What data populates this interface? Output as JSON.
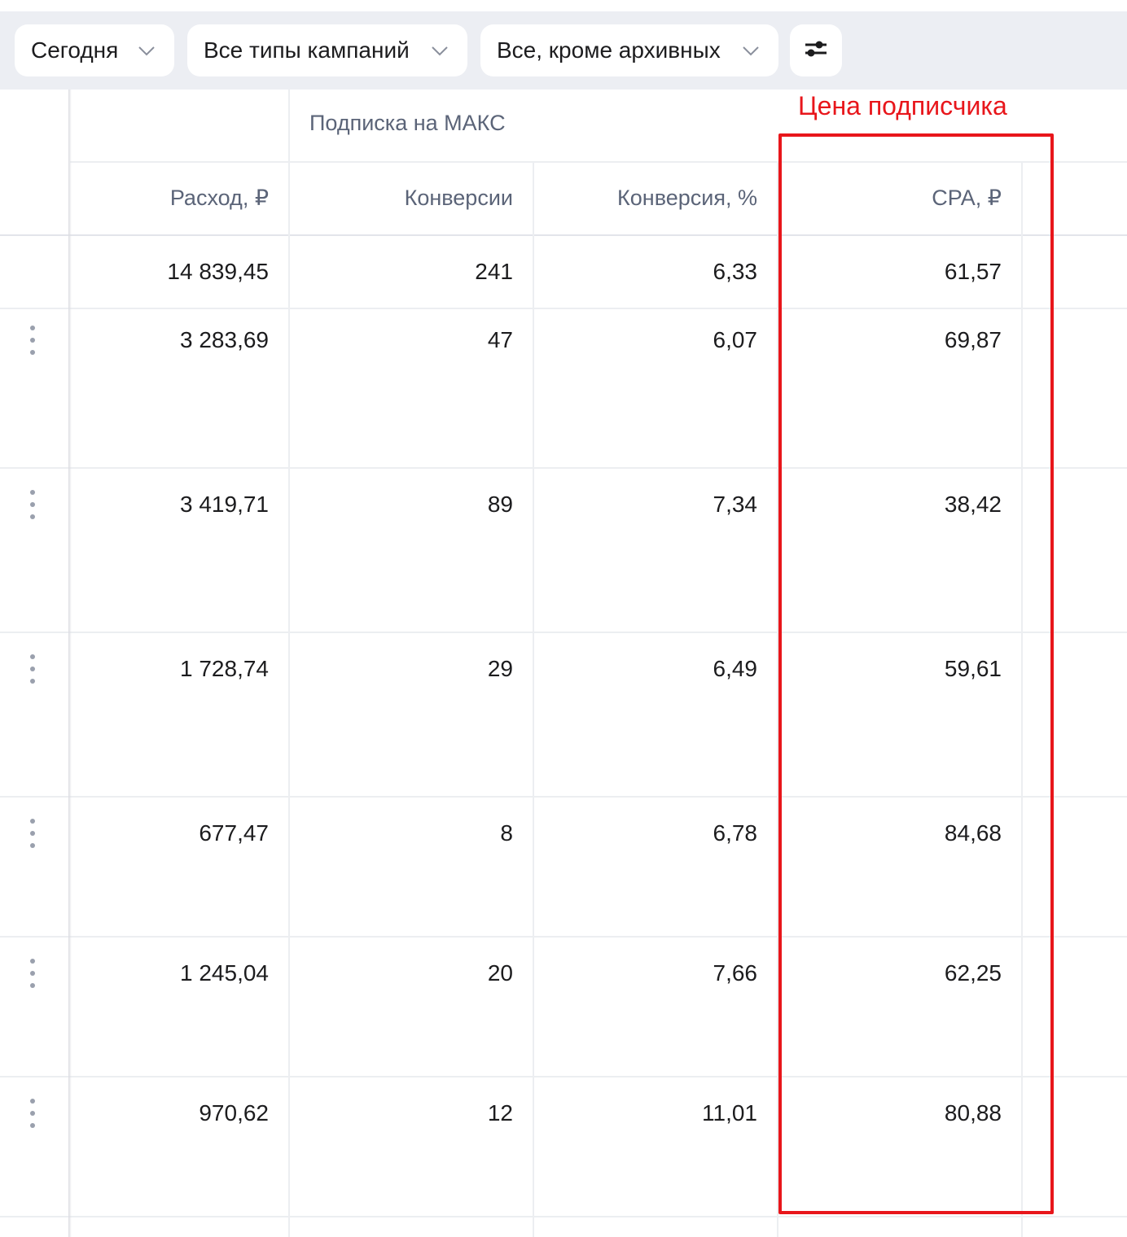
{
  "toolbar": {
    "period": "Сегодня",
    "campaign_types": "Все типы кампаний",
    "status_filter": "Все, кроме архивных",
    "settings_icon": "sliders-icon"
  },
  "table": {
    "group_header": "Подписка на МАКС",
    "columns": {
      "spend": "Расход, ₽",
      "conversions": "Конверсии",
      "conversion_rate": "Конверсия, %",
      "cpa": "CPA, ₽"
    },
    "total": {
      "spend": "14 839,45",
      "conversions": "241",
      "conversion_rate": "6,33",
      "cpa": "61,57"
    },
    "rows": [
      {
        "spend": "3 283,69",
        "conversions": "47",
        "conversion_rate": "6,07",
        "cpa": "69,87"
      },
      {
        "spend": "3 419,71",
        "conversions": "89",
        "conversion_rate": "7,34",
        "cpa": "38,42"
      },
      {
        "spend": "1 728,74",
        "conversions": "29",
        "conversion_rate": "6,49",
        "cpa": "59,61"
      },
      {
        "spend": "677,47",
        "conversions": "8",
        "conversion_rate": "6,78",
        "cpa": "84,68"
      },
      {
        "spend": "1 245,04",
        "conversions": "20",
        "conversion_rate": "7,66",
        "cpa": "62,25"
      },
      {
        "spend": "970,62",
        "conversions": "12",
        "conversion_rate": "11,01",
        "cpa": "80,88"
      }
    ]
  },
  "annotation": {
    "label": "Цена подписчика",
    "color": "#e8161b"
  }
}
